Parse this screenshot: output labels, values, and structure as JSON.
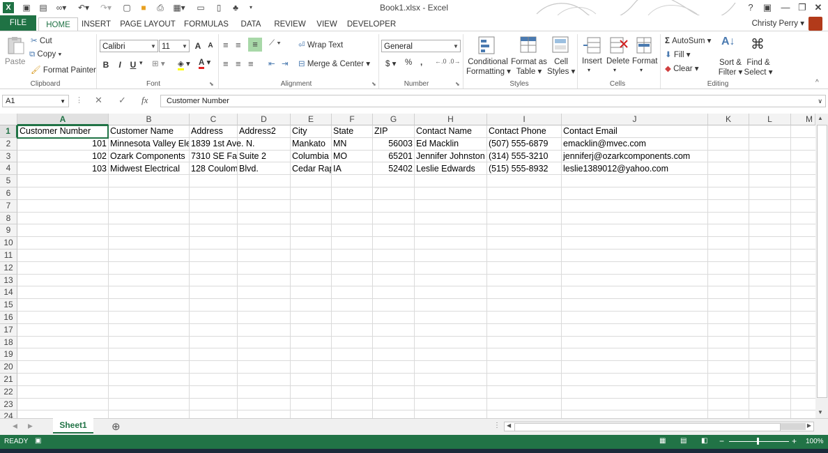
{
  "window": {
    "title": "Book1.xlsx - Excel",
    "help": "?",
    "user": "Christy Perry"
  },
  "tabs": [
    "FILE",
    "HOME",
    "INSERT",
    "PAGE LAYOUT",
    "FORMULAS",
    "DATA",
    "REVIEW",
    "VIEW",
    "DEVELOPER"
  ],
  "ribbon": {
    "clipboard": {
      "paste": "Paste",
      "cut": "Cut",
      "copy": "Copy",
      "format_painter": "Format Painter",
      "label": "Clipboard"
    },
    "font": {
      "name": "Calibri",
      "size": "11",
      "bold": "B",
      "italic": "I",
      "underline": "U",
      "grow": "A",
      "shrink": "A",
      "font_color": "A",
      "label": "Font"
    },
    "alignment": {
      "wrap_text": "Wrap Text",
      "merge_center": "Merge & Center",
      "label": "Alignment"
    },
    "number": {
      "format": "General",
      "currency": "$",
      "percent": "%",
      "comma": ",",
      "label": "Number"
    },
    "styles": {
      "conditional_1": "Conditional",
      "conditional_2": "Formatting",
      "format_table_1": "Format as",
      "format_table_2": "Table",
      "cell_styles_1": "Cell",
      "cell_styles_2": "Styles",
      "label": "Styles"
    },
    "cells": {
      "insert": "Insert",
      "delete": "Delete",
      "format": "Format",
      "label": "Cells"
    },
    "editing": {
      "autosum": "AutoSum",
      "fill": "Fill",
      "clear": "Clear",
      "sort_1": "Sort &",
      "sort_2": "Filter",
      "find_1": "Find &",
      "find_2": "Select",
      "label": "Editing"
    }
  },
  "formula_bar": {
    "name_box": "A1",
    "fx": "fx",
    "content": "Customer Number"
  },
  "columns": [
    "A",
    "B",
    "C",
    "D",
    "E",
    "F",
    "G",
    "H",
    "I",
    "J",
    "K",
    "L",
    "M"
  ],
  "rows": [
    "1",
    "2",
    "3",
    "4",
    "5",
    "6",
    "7",
    "8",
    "9",
    "10",
    "11",
    "12",
    "13",
    "14",
    "15",
    "16",
    "17",
    "18",
    "19",
    "20",
    "21",
    "22",
    "23",
    "24"
  ],
  "cells": {
    "header": [
      "Customer Number",
      "Customer Name",
      "Address",
      "Address2",
      "City",
      "State",
      "ZIP",
      "Contact Name",
      "Contact Phone",
      "Contact Email"
    ],
    "r2": [
      "101",
      "Minnesota Valley Ele",
      "1839 1st Ave. N.",
      "",
      "Mankato",
      "MN",
      "56003",
      "Ed Macklin",
      "(507) 555-6879",
      "emacklin@mvec.com"
    ],
    "r3": [
      "102",
      "Ozark Components",
      "7310 SE Far",
      "Suite 2",
      "Columbia",
      "MO",
      "65201",
      "Jennifer Johnston",
      "(314) 555-3210",
      "jenniferj@ozarkcomponents.com"
    ],
    "r4": [
      "103",
      "Midwest Electrical",
      "128 Coulomb",
      "Blvd.",
      "Cedar Rap",
      "IA",
      "52402",
      "Leslie Edwards",
      "(515) 555-8932",
      "leslie1389012@yahoo.com"
    ]
  },
  "sheet_tab": "Sheet1",
  "status": {
    "ready": "READY",
    "zoom": "100%"
  },
  "colors": {
    "excel_green": "#217346",
    "file_tab": "#1f7244"
  }
}
